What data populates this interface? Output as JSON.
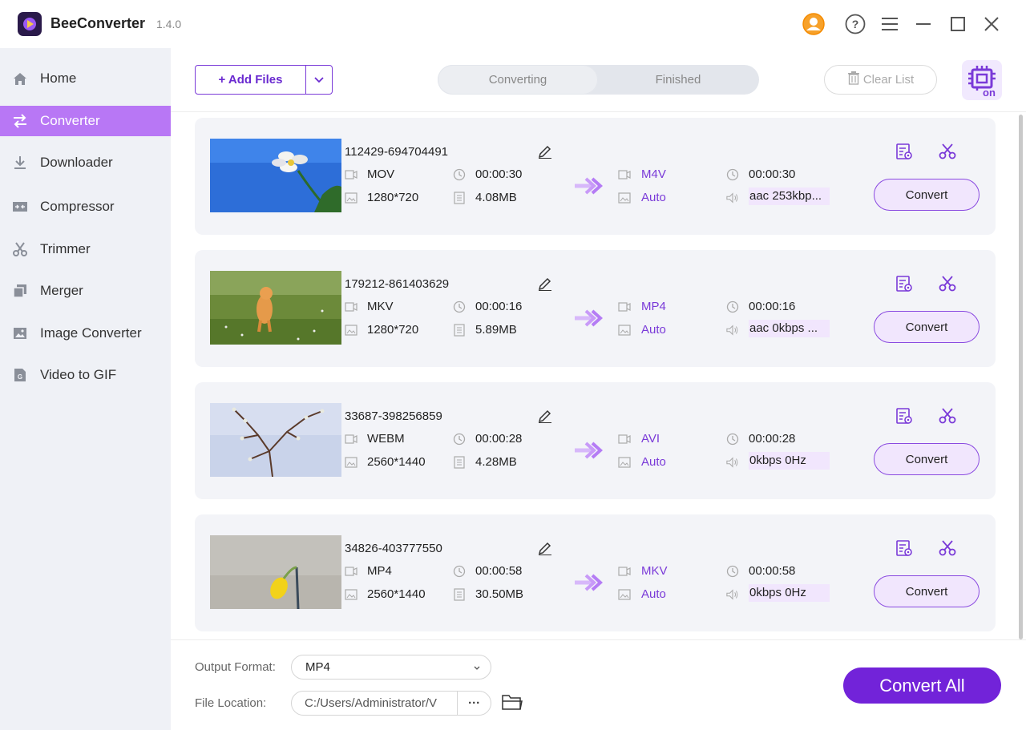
{
  "app": {
    "name": "BeeConverter",
    "version": "1.4.0"
  },
  "titlebar": {
    "icons": [
      "account-icon",
      "help-icon",
      "menu-icon",
      "minimize-icon",
      "maximize-icon",
      "close-icon"
    ]
  },
  "sidebar": {
    "items": [
      {
        "label": "Home",
        "icon": "home-icon"
      },
      {
        "label": "Converter",
        "icon": "converter-icon",
        "active": true
      },
      {
        "label": "Downloader",
        "icon": "download-icon"
      },
      {
        "label": "Compressor",
        "icon": "compressor-icon"
      },
      {
        "label": "Trimmer",
        "icon": "scissors-icon"
      },
      {
        "label": "Merger",
        "icon": "merger-icon"
      },
      {
        "label": "Image Converter",
        "icon": "image-icon"
      },
      {
        "label": "Video to GIF",
        "icon": "gif-icon"
      }
    ]
  },
  "toolbar": {
    "add_files": "+ Add Files",
    "tabs": [
      "Converting",
      "Finished"
    ],
    "active_tab": "Converting",
    "clear_list": "Clear List",
    "hw_accel_label": "on"
  },
  "files": [
    {
      "name": "112429-694704491",
      "format": "MOV",
      "duration": "00:00:30",
      "resolution": "1280*720",
      "size": "4.08MB",
      "out_format": "M4V",
      "out_duration": "00:00:30",
      "out_resolution": "Auto",
      "out_audio": "aac 253kbp...",
      "convert": "Convert"
    },
    {
      "name": "179212-861403629",
      "format": "MKV",
      "duration": "00:00:16",
      "resolution": "1280*720",
      "size": "5.89MB",
      "out_format": "MP4",
      "out_duration": "00:00:16",
      "out_resolution": "Auto",
      "out_audio": "aac 0kbps ...",
      "convert": "Convert"
    },
    {
      "name": "33687-398256859",
      "format": "WEBM",
      "duration": "00:00:28",
      "resolution": "2560*1440",
      "size": "4.28MB",
      "out_format": "AVI",
      "out_duration": "00:00:28",
      "out_resolution": "Auto",
      "out_audio": "0kbps 0Hz",
      "convert": "Convert"
    },
    {
      "name": "34826-403777550",
      "format": "MP4",
      "duration": "00:00:58",
      "resolution": "2560*1440",
      "size": "30.50MB",
      "out_format": "MKV",
      "out_duration": "00:00:58",
      "out_resolution": "Auto",
      "out_audio": "0kbps 0Hz",
      "convert": "Convert"
    }
  ],
  "bottom": {
    "output_format_label": "Output Format:",
    "output_format_value": "MP4",
    "file_location_label": "File Location:",
    "file_location_value": "C:/Users/Administrator/V",
    "more": "···",
    "convert_all": "Convert All"
  },
  "colors": {
    "accent": "#7223d9",
    "sidebar_active": "#b877f5",
    "sidebar_bg": "#eff1f6"
  }
}
